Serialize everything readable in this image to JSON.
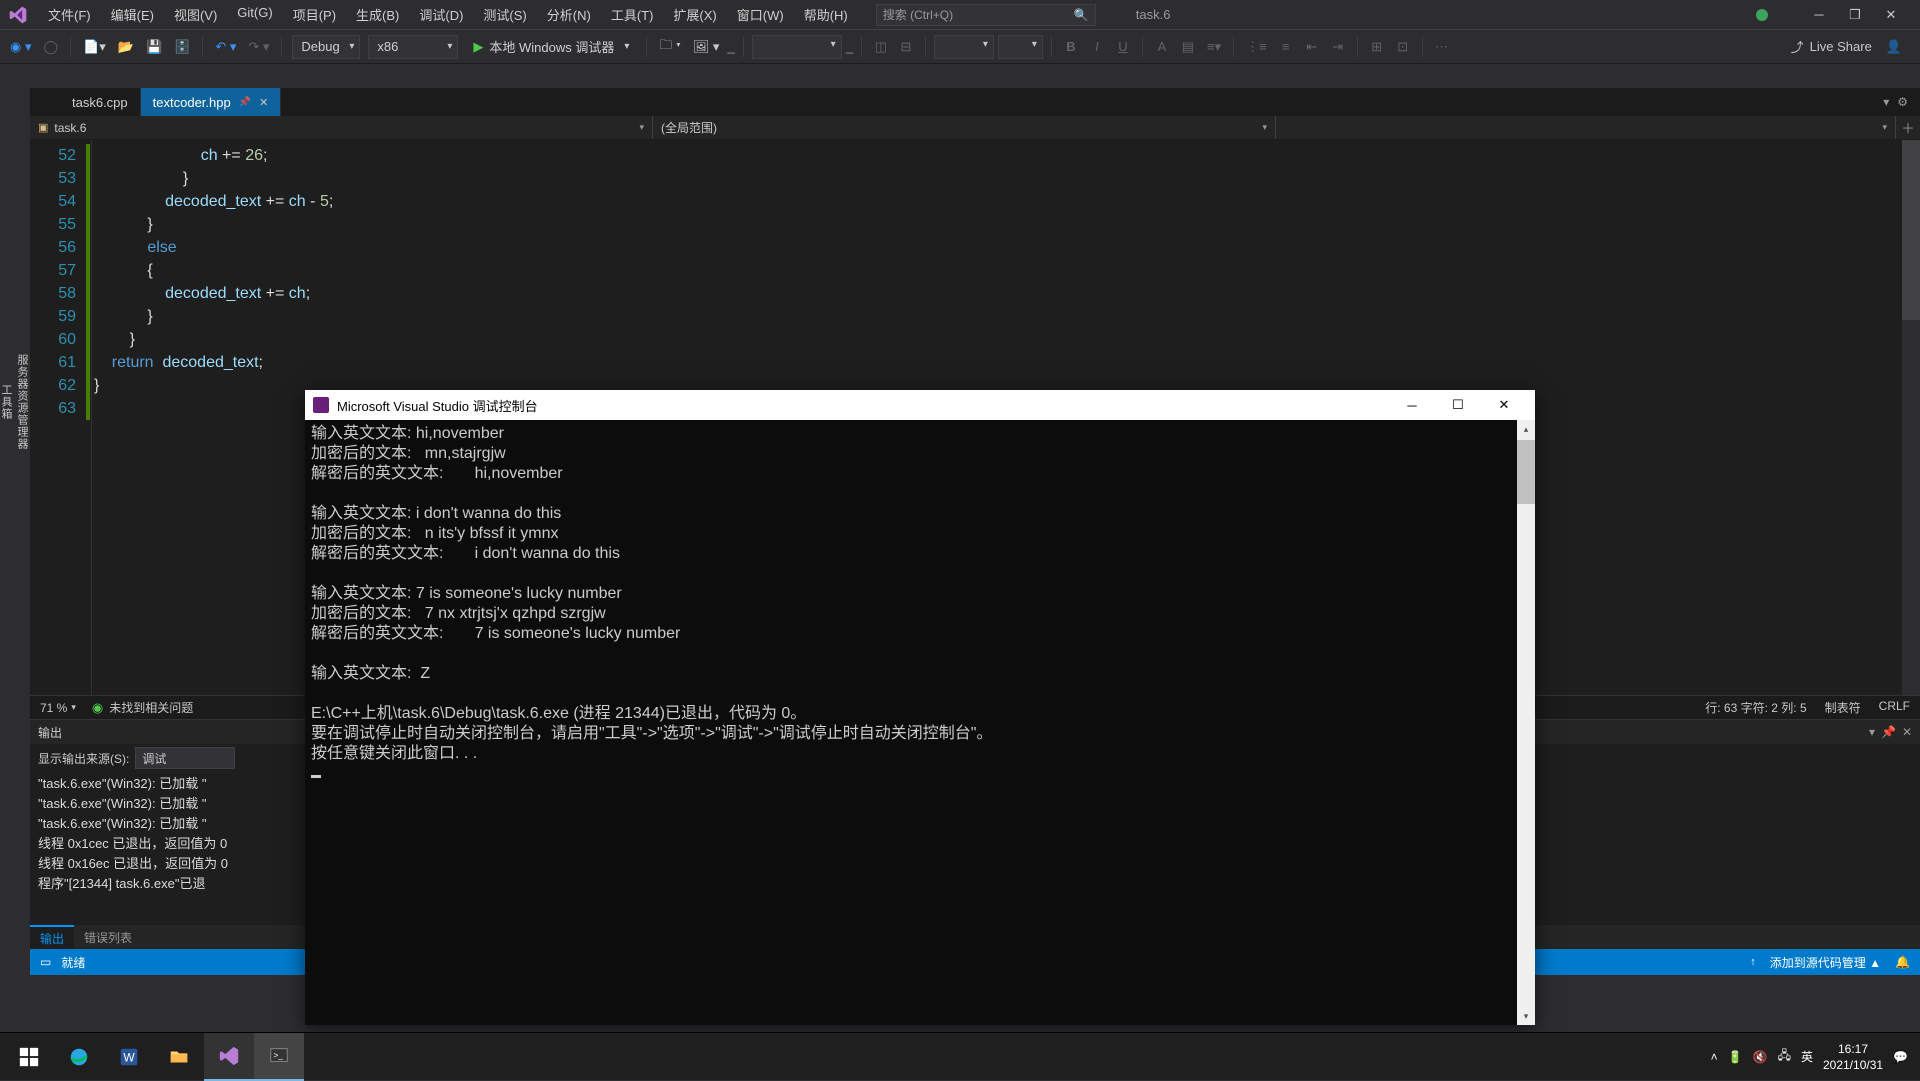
{
  "menubar": {
    "items": [
      "文件(F)",
      "编辑(E)",
      "视图(V)",
      "Git(G)",
      "项目(P)",
      "生成(B)",
      "调试(D)",
      "测试(S)",
      "分析(N)",
      "工具(T)",
      "扩展(X)",
      "窗口(W)",
      "帮助(H)"
    ],
    "search_placeholder": "搜索 (Ctrl+Q)",
    "solution": "task.6"
  },
  "toolbar": {
    "config": "Debug",
    "platform": "x86",
    "run_label": "本地 Windows 调试器",
    "liveshare": "Live Share"
  },
  "tabs": [
    {
      "name": "task6.cpp",
      "active": false
    },
    {
      "name": "textcoder.hpp",
      "active": true
    }
  ],
  "navbar": {
    "left": "task.6",
    "right": "(全局范围)"
  },
  "code": {
    "start": 52,
    "lines": [
      "                            ch += 26;",
      "                        }",
      "                    decoded_text += ch - 5;",
      "                }",
      "                else",
      "                {",
      "                    decoded_text += ch;",
      "                }",
      "            }",
      "        return  decoded_text;",
      "    }",
      ""
    ],
    "kw_else": "else",
    "kw_return": "return",
    "id_ch": "ch",
    "id_dec": "decoded_text",
    "num": "26",
    "num5": "5"
  },
  "editor_status": {
    "zoom": "71 %",
    "issues": "未找到相关问题",
    "pos": "行: 63    字符: 2    列: 5",
    "tabs": "制表符",
    "eol": "CRLF"
  },
  "output": {
    "title": "输出",
    "src_label": "显示输出来源(S):",
    "src_value": "调试",
    "lines": [
      "\"task.6.exe\"(Win32): 已加载 \"",
      "\"task.6.exe\"(Win32): 已加载 \"",
      "\"task.6.exe\"(Win32): 已加载 \"",
      "线程 0x1cec 已退出，返回值为 0",
      "线程 0x16ec 已退出，返回值为 0",
      "程序\"[21344] task.6.exe\"已退"
    ],
    "tab_output": "输出",
    "tab_errors": "错误列表"
  },
  "vs_status": {
    "ready": "就绪",
    "scm": "添加到源代码管理",
    "up": "▲"
  },
  "console": {
    "title": "Microsoft Visual Studio 调试控制台",
    "body": "输入英文文本: hi,november\n加密后的文本:   mn,stajrgjw\n解密后的英文文本:       hi,november\n\n输入英文文本: i don't wanna do this\n加密后的文本:   n its'y bfssf it ymnx\n解密后的英文文本:       i don't wanna do this\n\n输入英文文本: 7 is someone's lucky number\n加密后的文本:   7 nx xtrjtsj'x qzhpd szrgjw\n解密后的英文文本:       7 is someone's lucky number\n\n输入英文文本:  Z\n\nE:\\C++上机\\task.6\\Debug\\task.6.exe (进程 21344)已退出，代码为 0。\n要在调试停止时自动关闭控制台，请启用\"工具\"->\"选项\"->\"调试\"->\"调试停止时自动关闭控制台\"。\n按任意键关闭此窗口. . ."
  },
  "taskbar": {
    "ime": "英",
    "time": "16:17",
    "date": "2021/10/31"
  },
  "left_strip": [
    "服务器资源管理器",
    "工具箱"
  ]
}
